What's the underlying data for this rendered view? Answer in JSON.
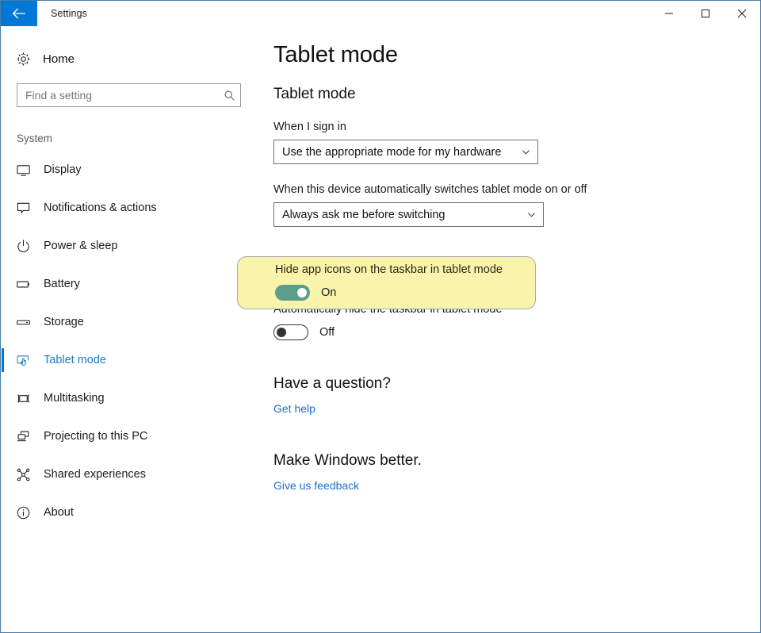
{
  "window": {
    "title": "Settings",
    "back_icon": "back-arrow-icon",
    "controls": {
      "minimize": "minimize-icon",
      "maximize": "maximize-icon",
      "close": "close-icon"
    }
  },
  "sidebar": {
    "home": {
      "label": "Home",
      "icon": "gear-icon"
    },
    "search": {
      "placeholder": "Find a setting",
      "value": "",
      "icon": "search-icon"
    },
    "group_label": "System",
    "items": [
      {
        "label": "Display",
        "icon": "monitor-icon",
        "selected": false
      },
      {
        "label": "Notifications & actions",
        "icon": "speech-bubble-icon",
        "selected": false
      },
      {
        "label": "Power & sleep",
        "icon": "power-icon",
        "selected": false
      },
      {
        "label": "Battery",
        "icon": "battery-icon",
        "selected": false
      },
      {
        "label": "Storage",
        "icon": "storage-icon",
        "selected": false
      },
      {
        "label": "Tablet mode",
        "icon": "tablet-touch-icon",
        "selected": true
      },
      {
        "label": "Multitasking",
        "icon": "multitasking-icon",
        "selected": false
      },
      {
        "label": "Projecting to this PC",
        "icon": "projecting-icon",
        "selected": false
      },
      {
        "label": "Shared experiences",
        "icon": "share-nodes-icon",
        "selected": false
      },
      {
        "label": "About",
        "icon": "info-circle-icon",
        "selected": false
      }
    ]
  },
  "main": {
    "page_title": "Tablet mode",
    "section_title": "Tablet mode",
    "sign_in": {
      "label": "When I sign in",
      "value": "Use the appropriate mode for my hardware",
      "chevron_icon": "chevron-down-icon"
    },
    "auto_switch": {
      "label": "When this device automatically switches tablet mode on or off",
      "value": "Always ask me before switching",
      "chevron_icon": "chevron-down-icon"
    },
    "hide_app_icons": {
      "label": "Hide app icons on the taskbar in tablet mode",
      "state": "On",
      "highlighted": true
    },
    "auto_hide_taskbar": {
      "label": "Automatically hide the taskbar in tablet mode",
      "state": "Off",
      "highlighted": false
    },
    "help": {
      "heading": "Have a question?",
      "link": "Get help"
    },
    "feedback": {
      "heading": "Make Windows better.",
      "link": "Give us feedback"
    }
  },
  "colors": {
    "accent": "#0078d7",
    "link": "#1f6fc4",
    "toggle_on": "#5b9e8e",
    "highlight_bg": "#faf3ac",
    "window_border": "#4a7ba7"
  }
}
